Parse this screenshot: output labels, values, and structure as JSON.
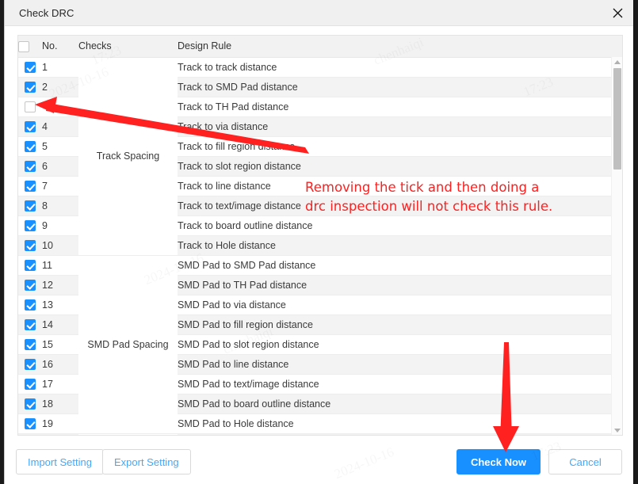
{
  "window": {
    "title": "Check DRC",
    "close_icon": "close-icon"
  },
  "table": {
    "columns": [
      "",
      "No.",
      "Checks",
      "Design Rule"
    ],
    "header_select_all_checked": false,
    "groups": [
      {
        "name": "Track Spacing",
        "row_span": 10
      },
      {
        "name": "SMD Pad Spacing",
        "row_span": 9
      }
    ],
    "rows": [
      {
        "no": "1",
        "rule": "Track to track distance",
        "checked": true
      },
      {
        "no": "2",
        "rule": "Track to SMD Pad distance",
        "checked": true
      },
      {
        "no": "",
        "rule": "Track to TH Pad distance",
        "checked": false
      },
      {
        "no": "4",
        "rule": "Track to via distance",
        "checked": true
      },
      {
        "no": "5",
        "rule": "Track to fill region distance",
        "checked": true
      },
      {
        "no": "6",
        "rule": "Track to slot region distance",
        "checked": true
      },
      {
        "no": "7",
        "rule": "Track to line distance",
        "checked": true
      },
      {
        "no": "8",
        "rule": "Track to text/image distance",
        "checked": true
      },
      {
        "no": "9",
        "rule": "Track to board outline distance",
        "checked": true
      },
      {
        "no": "10",
        "rule": "Track to Hole distance",
        "checked": true
      },
      {
        "no": "11",
        "rule": "SMD Pad to SMD Pad distance",
        "checked": true
      },
      {
        "no": "12",
        "rule": "SMD Pad to TH Pad distance",
        "checked": true
      },
      {
        "no": "13",
        "rule": "SMD Pad to via distance",
        "checked": true
      },
      {
        "no": "14",
        "rule": "SMD Pad to fill region distance",
        "checked": true
      },
      {
        "no": "15",
        "rule": "SMD Pad to slot region distance",
        "checked": true
      },
      {
        "no": "16",
        "rule": "SMD Pad to line distance",
        "checked": true
      },
      {
        "no": "17",
        "rule": "SMD Pad to text/image distance",
        "checked": true
      },
      {
        "no": "18",
        "rule": "SMD Pad to board outline distance",
        "checked": true
      },
      {
        "no": "19",
        "rule": "SMD Pad to Hole distance",
        "checked": true
      }
    ]
  },
  "scrollbar": {
    "up_arrow_icon": "triangle-up-icon",
    "down_arrow_icon": "triangle-down-icon"
  },
  "footer": {
    "import_setting": "Import Setting",
    "export_setting": "Export Setting",
    "check_now": "Check Now",
    "cancel": "Cancel"
  },
  "annotation": {
    "note_line1": "Removing the tick and then doing a",
    "note_line2": "drc inspection will not check this rule.",
    "color": "#ff2020",
    "arrow_to_checkbox": "arrow-pointing-to-unchecked-checkbox",
    "arrow_to_check_now": "arrow-pointing-to-check-now-button"
  },
  "colors": {
    "accent": "#1890ff",
    "link": "#40a9ff",
    "annotation_red": "#ff2020",
    "header_bg": "#f2f2f2",
    "row_alt_bg": "#f3f3f3"
  },
  "watermarks": [
    "2024-10-16",
    "chenhaiqi",
    "17:23",
    "2024-10-16",
    "chenhaiqi",
    "17:23"
  ]
}
